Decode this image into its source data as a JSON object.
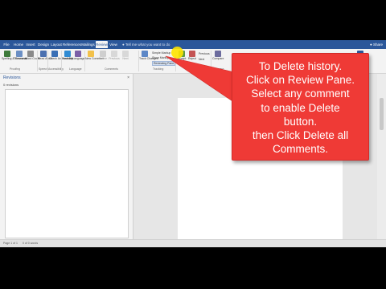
{
  "tabs": [
    "File",
    "Home",
    "Insert",
    "Design",
    "Layout",
    "References",
    "Mailings",
    "Review",
    "View"
  ],
  "active_tab": "Review",
  "tell_me": "Tell me what you want to do",
  "share_label": "Share",
  "ribbon": {
    "proofing": {
      "spelling": "Spelling & Grammar",
      "thesaurus": "Thesaurus",
      "word_count": "Word Count",
      "group": "Proofing"
    },
    "speech": {
      "read_aloud": "Read Aloud",
      "group": "Speech"
    },
    "accessibility": {
      "check": "Check Accessibility",
      "group": "Accessibility"
    },
    "language": {
      "translate": "Translate",
      "language": "Language",
      "group": "Language"
    },
    "comments": {
      "new_comment": "New Comment",
      "delete": "Delete",
      "previous": "Previous",
      "next": "Next",
      "show": "Show Comments",
      "group": "Comments"
    },
    "tracking": {
      "track": "Track Changes",
      "markup": "Simple Markup",
      "show_markup": "Show Markup",
      "reviewing_pane": "Reviewing Pane",
      "group": "Tracking"
    },
    "changes": {
      "accept": "Accept",
      "reject": "Reject",
      "previous": "Previous",
      "next": "Next",
      "group": "Changes"
    },
    "compare": {
      "compare": "Compare",
      "group": "Compare"
    },
    "protect": {
      "block": "Block Authors",
      "restrict": "Restrict Editing",
      "group": "Protect"
    },
    "ink": {
      "hide_ink": "Hide Ink",
      "group": "Ink"
    }
  },
  "pane": {
    "title": "Revisions",
    "subtitle": "0 revisions",
    "close": "×"
  },
  "status": {
    "page": "Page 1 of 1",
    "words": "0 of 0 words"
  },
  "callout": {
    "lines": [
      "To Delete history.",
      "Click on Review Pane.",
      "Select any comment",
      "to enable Delete",
      "button.",
      "then Click Delete all",
      "Comments."
    ]
  },
  "colors": {
    "brand": "#2b579a",
    "callout": "#ef3a36",
    "highlight": "#ffe600"
  }
}
